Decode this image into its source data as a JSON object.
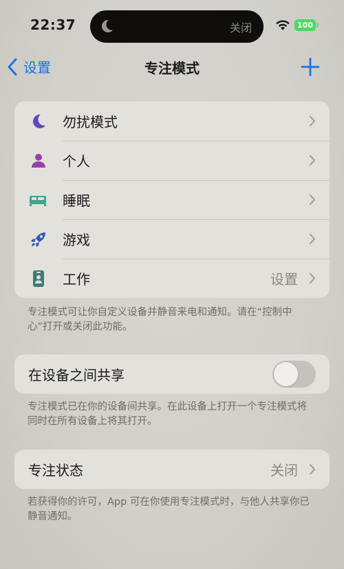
{
  "status_bar": {
    "time": "22:37",
    "island_text": "关闭",
    "battery": "100"
  },
  "nav": {
    "back_label": "设置",
    "title": "专注模式"
  },
  "focus_modes": [
    {
      "label": "勿扰模式",
      "icon": "moon-icon",
      "value": "",
      "color": "#5c4bb8"
    },
    {
      "label": "个人",
      "icon": "person-icon",
      "value": "",
      "color": "#9b3fa8"
    },
    {
      "label": "睡眠",
      "icon": "bed-icon",
      "value": "",
      "color": "#3fa58f"
    },
    {
      "label": "游戏",
      "icon": "rocket-icon",
      "value": "",
      "color": "#2f5db8"
    },
    {
      "label": "工作",
      "icon": "id-badge-icon",
      "value": "设置",
      "color": "#3f7a76"
    }
  ],
  "modes_note": "专注模式可让你自定义设备并静音来电和通知。请在“控制中心”打开或关闭此功能。",
  "share": {
    "label": "在设备之间共享",
    "enabled": false,
    "note": "专注模式已在你的设备间共享。在此设备上打开一个专注模式将同时在所有设备上将其打开。"
  },
  "focus_status": {
    "label": "专注状态",
    "value": "关闭",
    "note": "若获得你的许可，App 可在你使用专注模式时，与他人共享你已静音通知。"
  },
  "colors": {
    "accent": "#1a73e0",
    "battery": "#4cd964"
  }
}
